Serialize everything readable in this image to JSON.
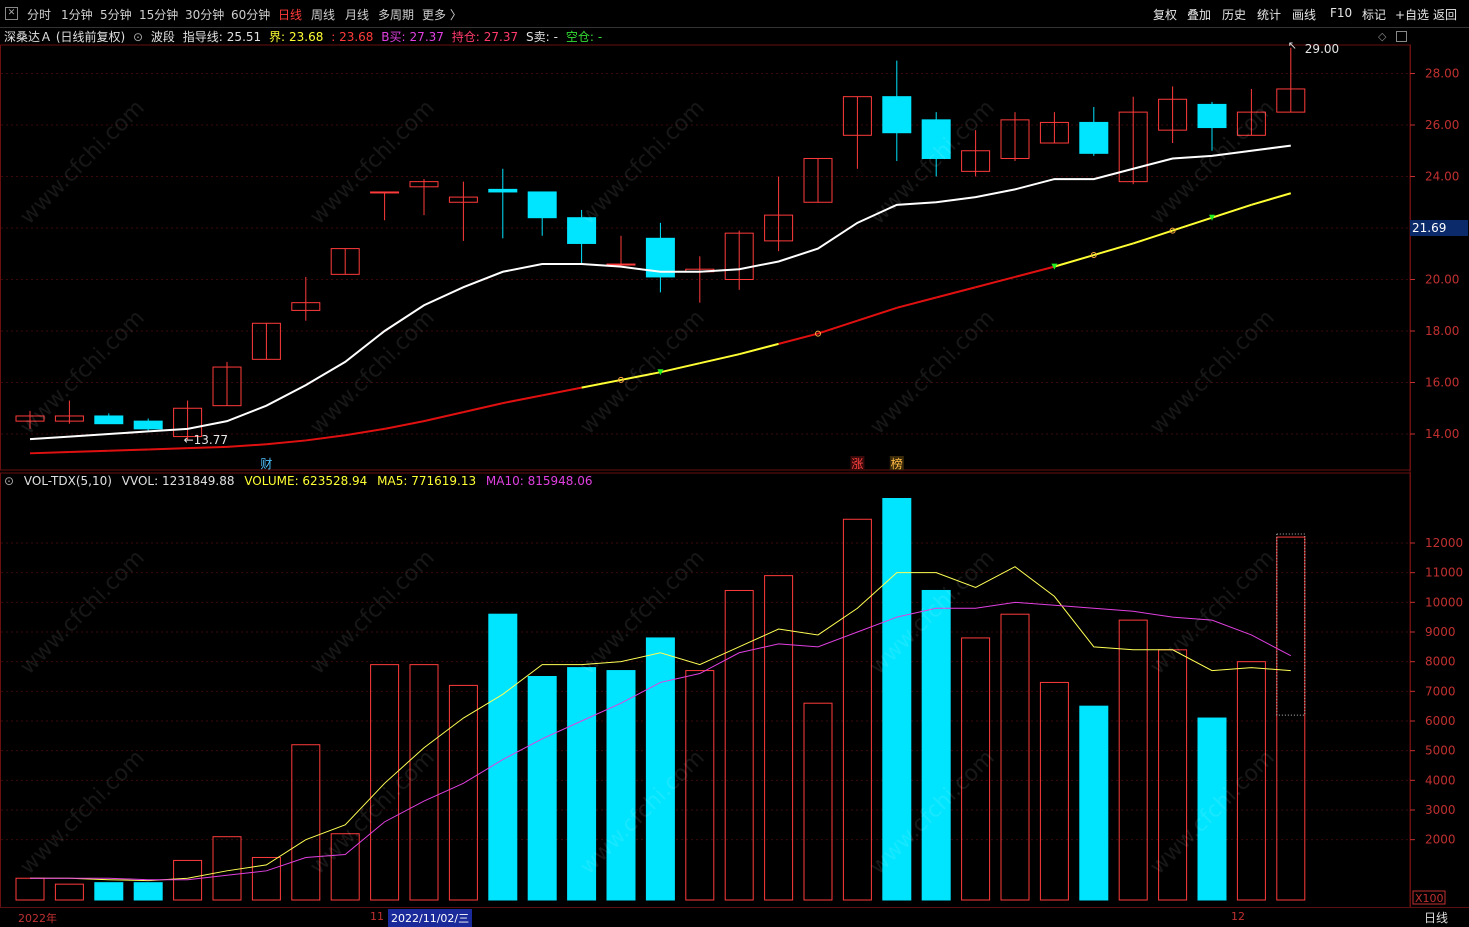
{
  "toolbar": {
    "left": [
      "分时",
      "1分钟",
      "5分钟",
      "15分钟",
      "30分钟",
      "60分钟",
      "日线",
      "周线",
      "月线",
      "多周期",
      "更多 〉"
    ],
    "active": "日线",
    "right": [
      "复权",
      "叠加",
      "历史",
      "统计",
      "画线",
      "F10",
      "标记",
      "+自选",
      "返回"
    ]
  },
  "info": {
    "stock": "深桑达Ａ (日线前复权)",
    "indicator": "波段",
    "guide_label": "指导线:",
    "guide_value": "25.51",
    "bound_label": "界:",
    "bound_value": "23.68",
    "bound_value2": ": 23.68",
    "buy_label": "B买:",
    "buy_value": "27.37",
    "hold_label": "持仓:",
    "hold_value": "27.37",
    "sell_label": "S卖:",
    "sell_value": "-",
    "empty_label": "空仓:",
    "empty_value": "-"
  },
  "vol_info": {
    "name": "VOL-TDX(5,10)",
    "vvol": "VVOL: 1231849.88",
    "volume": "VOLUME: 623528.94",
    "ma5": "MA5: 771619.13",
    "ma10": "MA10: 815948.06"
  },
  "price_tag": "21.69",
  "annotations": {
    "high": "29.00",
    "low": "13.77",
    "cai": "财",
    "zhang": "涨",
    "bang": "榜"
  },
  "bottom": {
    "year": "2022年",
    "m11": "11",
    "date": "2022/11/02/三",
    "m12": "12",
    "period": "日线"
  },
  "watermark": "www.cfchi.com",
  "colors": {
    "up": "#ff3b3b",
    "down": "#00e5ff",
    "ma_white": "#ffffff",
    "vol_ma5": "#ffff55",
    "vol_ma10": "#e040e0",
    "line_red": "#e01010",
    "line_yellow": "#ffff33"
  },
  "chart_data": [
    {
      "type": "candlestick",
      "title": "深桑达Ａ (日线前复权)",
      "ylim": [
        13,
        30
      ],
      "yticks": [
        14.0,
        16.0,
        18.0,
        20.0,
        22.0,
        24.0,
        26.0,
        28.0
      ],
      "candles": [
        {
          "o": 14.5,
          "h": 14.9,
          "l": 14.2,
          "c": 14.7
        },
        {
          "o": 14.5,
          "h": 15.3,
          "l": 14.4,
          "c": 14.7
        },
        {
          "o": 14.7,
          "h": 14.8,
          "l": 14.4,
          "c": 14.4
        },
        {
          "o": 14.5,
          "h": 14.6,
          "l": 14.1,
          "c": 14.2
        },
        {
          "o": 13.9,
          "h": 15.3,
          "l": 13.77,
          "c": 15.0
        },
        {
          "o": 15.1,
          "h": 16.8,
          "l": 15.1,
          "c": 16.6
        },
        {
          "o": 16.9,
          "h": 18.3,
          "l": 16.9,
          "c": 18.3
        },
        {
          "o": 18.8,
          "h": 20.1,
          "l": 18.4,
          "c": 19.1
        },
        {
          "o": 20.2,
          "h": 21.2,
          "l": 20.2,
          "c": 21.2
        },
        {
          "o": 23.4,
          "h": 23.4,
          "l": 22.3,
          "c": 23.4
        },
        {
          "o": 23.6,
          "h": 23.9,
          "l": 22.5,
          "c": 23.8
        },
        {
          "o": 23.0,
          "h": 23.8,
          "l": 21.5,
          "c": 23.2
        },
        {
          "o": 23.5,
          "h": 24.3,
          "l": 21.6,
          "c": 23.4
        },
        {
          "o": 23.4,
          "h": 23.4,
          "l": 21.7,
          "c": 22.4
        },
        {
          "o": 22.4,
          "h": 22.7,
          "l": 20.6,
          "c": 21.4
        },
        {
          "o": 20.6,
          "h": 21.7,
          "l": 20.6,
          "c": 20.6
        },
        {
          "o": 21.6,
          "h": 22.2,
          "l": 19.5,
          "c": 20.1
        },
        {
          "o": 20.3,
          "h": 20.9,
          "l": 19.1,
          "c": 20.4
        },
        {
          "o": 20.0,
          "h": 21.9,
          "l": 19.6,
          "c": 21.8
        },
        {
          "o": 21.5,
          "h": 24.0,
          "l": 21.1,
          "c": 22.5
        },
        {
          "o": 23.0,
          "h": 24.7,
          "l": 23.0,
          "c": 24.7
        },
        {
          "o": 25.6,
          "h": 27.1,
          "l": 24.3,
          "c": 27.1
        },
        {
          "o": 27.1,
          "h": 28.5,
          "l": 24.6,
          "c": 25.7
        },
        {
          "o": 26.2,
          "h": 26.5,
          "l": 24.0,
          "c": 24.7
        },
        {
          "o": 24.2,
          "h": 25.8,
          "l": 24.0,
          "c": 25.0
        },
        {
          "o": 24.7,
          "h": 26.5,
          "l": 24.6,
          "c": 26.2
        },
        {
          "o": 25.3,
          "h": 26.5,
          "l": 25.3,
          "c": 26.1
        },
        {
          "o": 26.1,
          "h": 26.7,
          "l": 24.8,
          "c": 24.9
        },
        {
          "o": 23.8,
          "h": 27.1,
          "l": 23.7,
          "c": 26.5
        },
        {
          "o": 25.8,
          "h": 27.5,
          "l": 25.3,
          "c": 27.0
        },
        {
          "o": 26.8,
          "h": 26.9,
          "l": 25.0,
          "c": 25.9
        },
        {
          "o": 25.6,
          "h": 27.4,
          "l": 25.6,
          "c": 26.5
        },
        {
          "o": 26.5,
          "h": 29.0,
          "l": 26.5,
          "c": 27.4
        }
      ],
      "ma_white": [
        13.8,
        13.9,
        14.0,
        14.1,
        14.2,
        14.5,
        15.1,
        15.9,
        16.8,
        18.0,
        19.0,
        19.7,
        20.3,
        20.6,
        20.6,
        20.5,
        20.3,
        20.3,
        20.4,
        20.7,
        21.2,
        22.2,
        22.9,
        23.0,
        23.2,
        23.5,
        23.9,
        23.9,
        24.3,
        24.7,
        24.8,
        25.0,
        25.2
      ],
      "band_line": [
        13.25,
        13.3,
        13.35,
        13.4,
        13.45,
        13.5,
        13.6,
        13.75,
        13.95,
        14.2,
        14.5,
        14.85,
        15.2,
        15.5,
        15.8,
        16.1,
        16.4,
        16.75,
        17.1,
        17.5,
        17.9,
        18.4,
        18.9,
        19.3,
        19.7,
        20.1,
        20.5,
        20.95,
        21.4,
        21.9,
        22.4,
        22.9,
        23.35
      ],
      "band_color": [
        "r",
        "r",
        "r",
        "r",
        "r",
        "r",
        "r",
        "r",
        "r",
        "r",
        "r",
        "r",
        "r",
        "r",
        "r",
        "y",
        "y",
        "y",
        "y",
        "y",
        "r",
        "r",
        "r",
        "r",
        "r",
        "r",
        "r",
        "y",
        "y",
        "y",
        "y",
        "y",
        "y"
      ]
    },
    {
      "type": "bar",
      "title": "VOL-TDX(5,10)",
      "ylim": [
        0,
        13500
      ],
      "yticks": [
        2000,
        3000,
        4000,
        5000,
        6000,
        7000,
        8000,
        9000,
        10000,
        11000,
        12000
      ],
      "ytick_label_suffix": "X100",
      "values": [
        700,
        500,
        550,
        550,
        1300,
        2100,
        1400,
        5200,
        2200,
        7900,
        7900,
        7200,
        9600,
        7500,
        7800,
        7700,
        8800,
        7700,
        10400,
        10900,
        6600,
        12800,
        13500,
        10400,
        8800,
        9600,
        7300,
        6500,
        9400,
        8400,
        6100,
        8000,
        12200
      ],
      "dir": [
        "u",
        "u",
        "d",
        "d",
        "u",
        "u",
        "u",
        "u",
        "u",
        "u",
        "u",
        "u",
        "d",
        "d",
        "d",
        "d",
        "d",
        "u",
        "u",
        "u",
        "u",
        "u",
        "d",
        "d",
        "u",
        "u",
        "u",
        "d",
        "u",
        "u",
        "d",
        "u",
        "u"
      ],
      "ma5": [
        700,
        700,
        650,
        620,
        700,
        950,
        1150,
        2000,
        2500,
        3900,
        5100,
        6100,
        6900,
        7900,
        7900,
        8000,
        8300,
        7900,
        8500,
        9100,
        8900,
        9800,
        11000,
        11000,
        10500,
        11200,
        10200,
        8500,
        8400,
        8400,
        7700,
        7800,
        7700
      ],
      "ma10": [
        700,
        700,
        700,
        650,
        650,
        800,
        950,
        1400,
        1500,
        2600,
        3300,
        3900,
        4700,
        5400,
        6000,
        6600,
        7300,
        7600,
        8300,
        8600,
        8500,
        9000,
        9500,
        9800,
        9800,
        10000,
        9900,
        9800,
        9700,
        9500,
        9400,
        8900,
        8200
      ]
    }
  ]
}
